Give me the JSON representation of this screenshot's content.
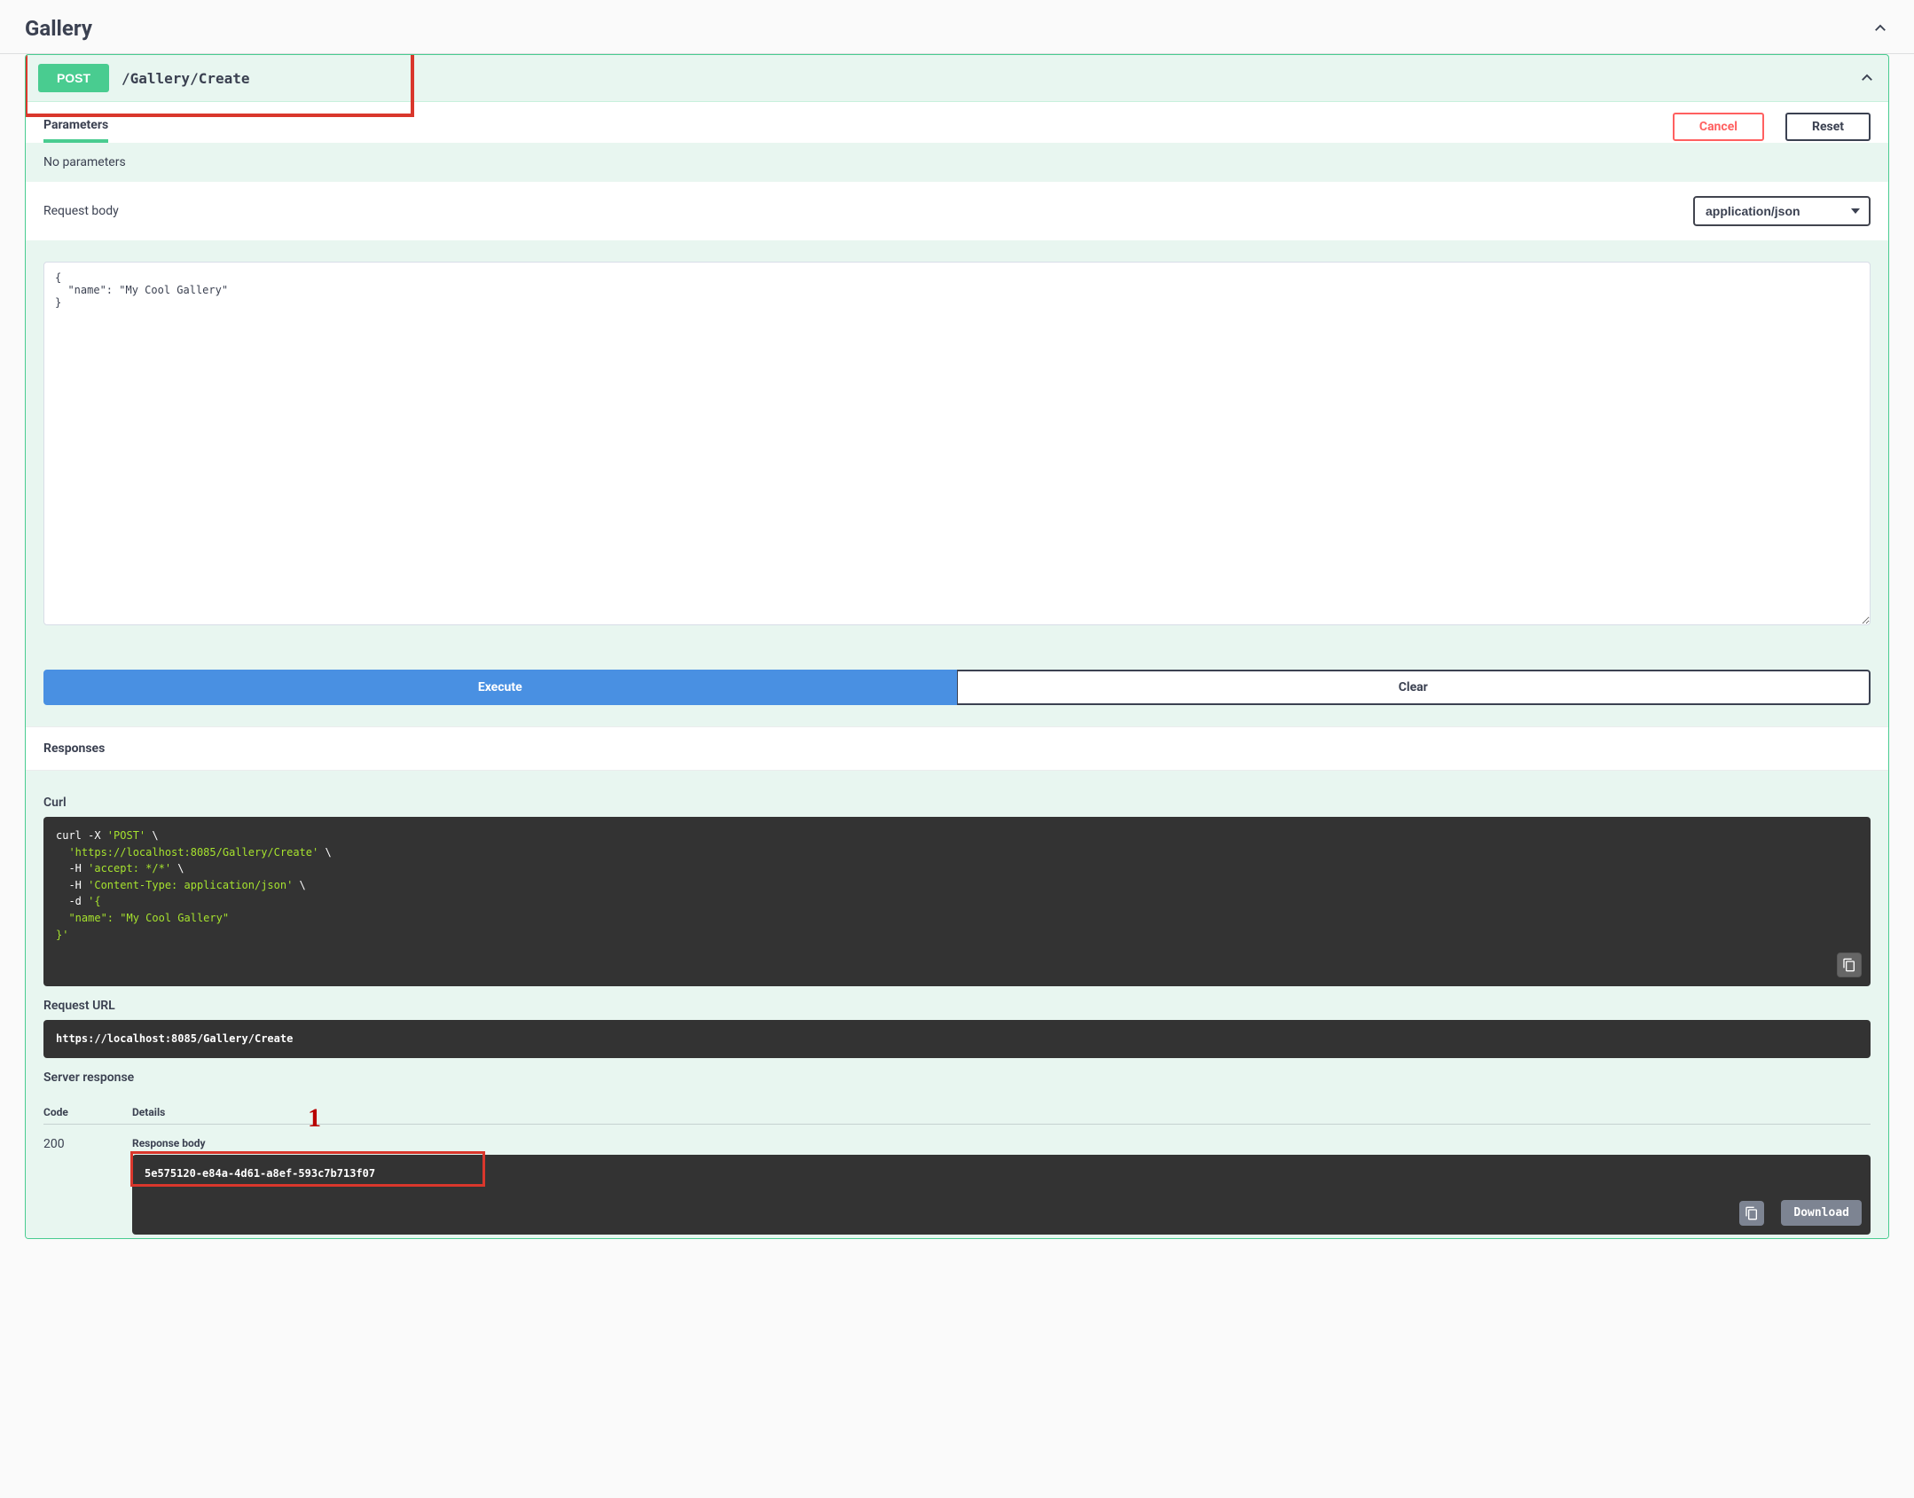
{
  "tag": {
    "title": "Gallery"
  },
  "operation": {
    "method": "POST",
    "path": "/Gallery/Create"
  },
  "tabs": {
    "parameters_label": "Parameters",
    "cancel_label": "Cancel",
    "reset_label": "Reset"
  },
  "parameters": {
    "none_text": "No parameters"
  },
  "request_body": {
    "label": "Request body",
    "content_type": "application/json",
    "body_text": "{\n  \"name\": \"My Cool Gallery\"\n}"
  },
  "actions": {
    "execute_label": "Execute",
    "clear_label": "Clear"
  },
  "responses": {
    "header": "Responses",
    "curl_label": "Curl",
    "curl_lines": {
      "l1a": "curl -X ",
      "l1b": "'POST'",
      "l1c": " \\",
      "l2a": "  ",
      "l2b": "'https://localhost:8085/Gallery/Create'",
      "l2c": " \\",
      "l3a": "  -H ",
      "l3b": "'accept: */*'",
      "l3c": " \\",
      "l4a": "  -H ",
      "l4b": "'Content-Type: application/json'",
      "l4c": " \\",
      "l5a": "  -d ",
      "l5b": "'{",
      "l6": "  \"name\": \"My Cool Gallery\"",
      "l7": "}'"
    },
    "request_url_label": "Request URL",
    "request_url": "https://localhost:8085/Gallery/Create",
    "server_response_label": "Server response",
    "columns": {
      "code": "Code",
      "details": "Details"
    },
    "code": "200",
    "response_body_label": "Response body",
    "response_body_value": "5e575120-e84a-4d61-a8ef-593c7b713f07",
    "download_label": "Download"
  },
  "annotations": {
    "marker1": "1"
  }
}
